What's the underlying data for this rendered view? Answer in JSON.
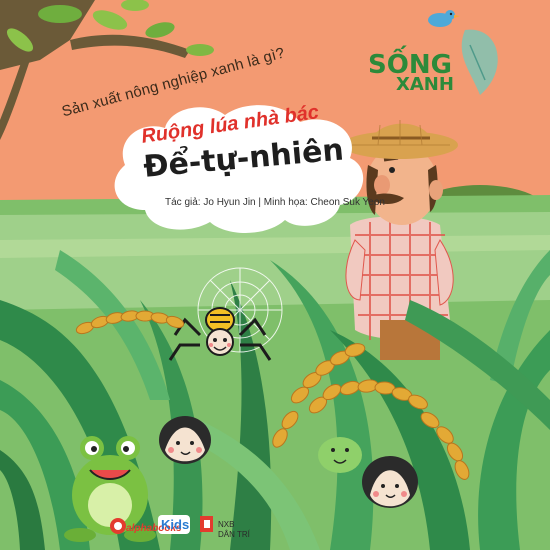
{
  "subtitle": "Sản xuất nông nghiệp xanh là gì?",
  "title_line1": "Ruộng lúa nhà bác",
  "title_line2": "Để-tự-nhiên",
  "author_credit": "Tác giả: Jo Hyun Jin",
  "illustrator_credit": "Minh họa: Cheon Suk Yeon",
  "credit_separator": "|",
  "series": {
    "word1": "SỐNG",
    "word2": "XANH"
  },
  "publishers": {
    "alphabooks": "alphabooks",
    "kids": "Kids",
    "nxb_line1": "NXB",
    "nxb_line2": "DÂN TRÍ"
  },
  "colors": {
    "background": "#f39a72",
    "title_red": "#e0312b",
    "series_green": "#2c8a3a"
  }
}
